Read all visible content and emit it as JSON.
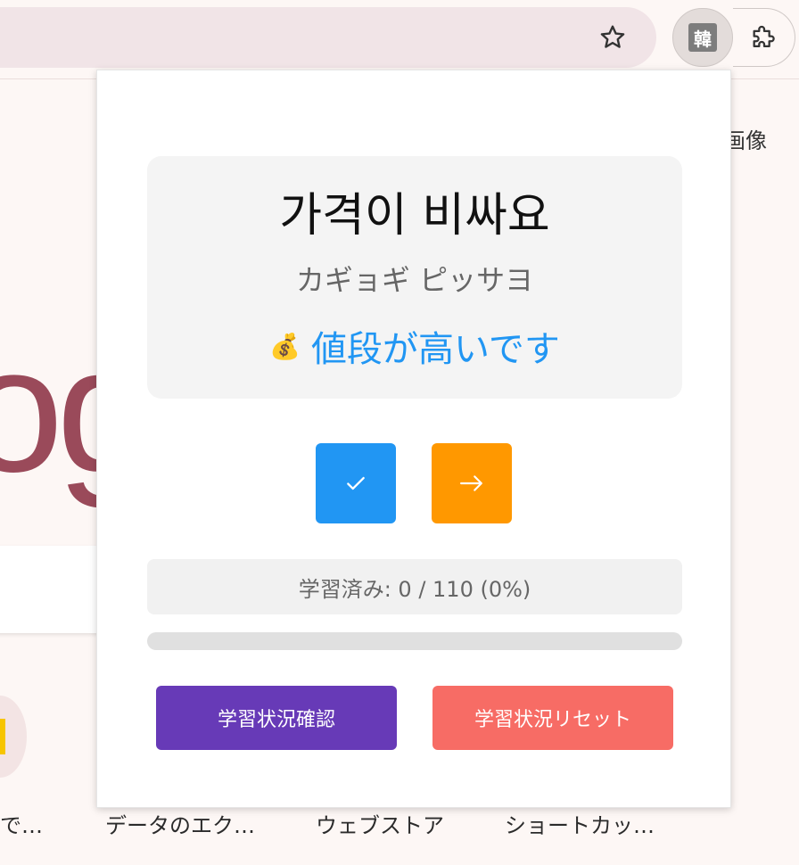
{
  "browser": {
    "extension_badge": "韓",
    "bg_label_image": "画像",
    "shortcuts": [
      "で…",
      "データのエク…",
      "ウェブストア",
      "ショートカッ…"
    ],
    "bg_logo_text": "og"
  },
  "card": {
    "korean": "가격이 비싸요",
    "reading": "カギョギ ピッサヨ",
    "emoji": "💰",
    "meaning": "値段が高いです"
  },
  "buttons": {
    "check_icon": "check-icon",
    "next_icon": "arrow-right-icon",
    "status": "学習状況確認",
    "reset": "学習状況リセット"
  },
  "progress": {
    "text": "学習済み: 0 / 110 (0%)",
    "learned": 0,
    "total": 110,
    "fraction": 0
  },
  "colors": {
    "check": "#2196f3",
    "next": "#ff9800",
    "status": "#673ab7",
    "reset": "#f76c65",
    "meaning": "#2196f3"
  }
}
